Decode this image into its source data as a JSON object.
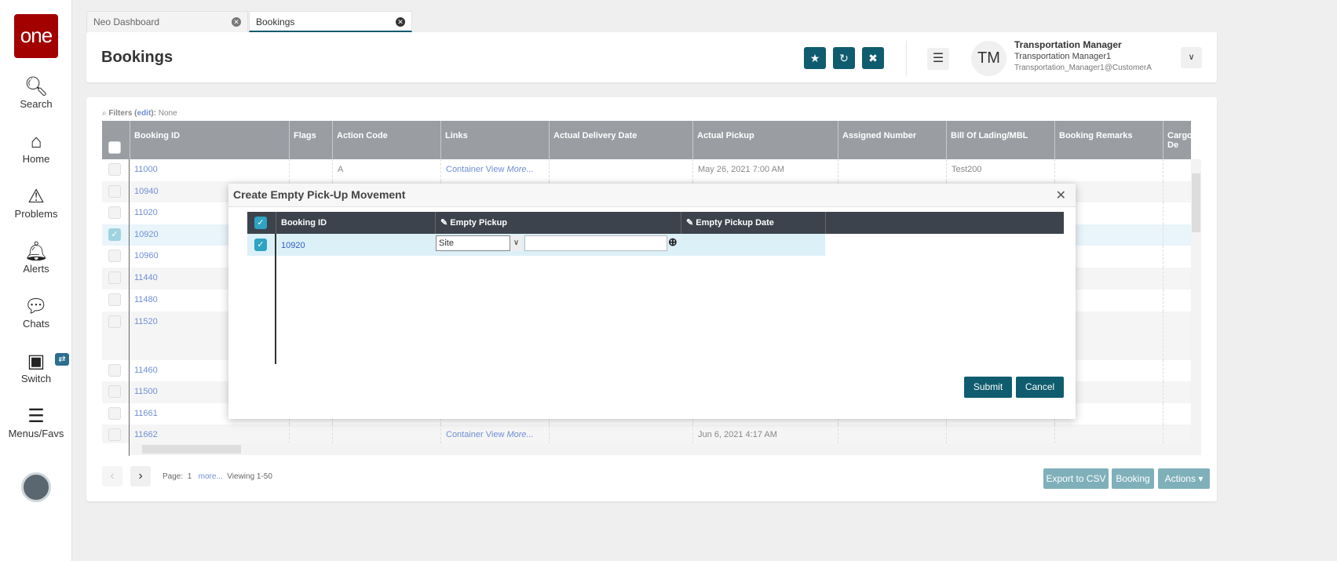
{
  "sidebar": {
    "logo": "one",
    "items": [
      {
        "label": "Search",
        "icon": "search-icon"
      },
      {
        "label": "Home",
        "icon": "home-icon"
      },
      {
        "label": "Problems",
        "icon": "warning-icon"
      },
      {
        "label": "Alerts",
        "icon": "bell-icon"
      },
      {
        "label": "Chats",
        "icon": "chat-icon"
      },
      {
        "label": "Switch",
        "icon": "switch-icon"
      },
      {
        "label": "Menus/Favs",
        "icon": "menu-icon"
      }
    ]
  },
  "tabs": [
    {
      "label": "Neo Dashboard"
    },
    {
      "label": "Bookings",
      "active": true
    }
  ],
  "header": {
    "title": "Bookings",
    "user_initials": "TM",
    "user_role": "Transportation Manager",
    "user_name": "Transportation Manager1",
    "user_email": "Transportation_Manager1@CustomerA"
  },
  "filters": {
    "label": "Filters (",
    "edit": "edit",
    "suffix": "):",
    "value": "None"
  },
  "table": {
    "columns": [
      "Booking ID",
      "Flags",
      "Action Code",
      "Links",
      "Actual Delivery Date",
      "Actual Pickup",
      "Assigned Number",
      "Bill Of Lading/MBL",
      "Booking Remarks",
      "Cargo De"
    ],
    "rows": [
      {
        "id": "11000",
        "action": "A",
        "links": "Container View",
        "more": "More...",
        "pickup": "May 26, 2021 7:00 AM",
        "bol": "Test200"
      },
      {
        "id": "10940"
      },
      {
        "id": "11020"
      },
      {
        "id": "10920",
        "selected": true
      },
      {
        "id": "10960"
      },
      {
        "id": "11440"
      },
      {
        "id": "11480"
      },
      {
        "id": "11520"
      },
      {
        "id": "11460"
      },
      {
        "id": "11500"
      },
      {
        "id": "11661"
      },
      {
        "id": "11662",
        "links": "Container View",
        "more": "More...",
        "pickup": "Jun 6, 2021 4:17 AM"
      }
    ]
  },
  "pager": {
    "page_label": "Page:",
    "page": "1",
    "more": "more...",
    "viewing": "Viewing 1-50"
  },
  "footer_buttons": {
    "export": "Export to CSV",
    "booking": "Booking",
    "actions": "Actions"
  },
  "modal": {
    "title": "Create Empty Pick-Up Movement",
    "columns": [
      "Booking ID",
      "Empty Pickup",
      "Empty Pickup Date"
    ],
    "row": {
      "id": "10920",
      "pickup_type": "Site",
      "pickup_value": ""
    },
    "submit": "Submit",
    "cancel": "Cancel"
  },
  "colors": {
    "accent": "#0f5c6e",
    "brand": "#a30000",
    "header_gray": "#9a9ea3",
    "modal_header": "#3c434c"
  }
}
